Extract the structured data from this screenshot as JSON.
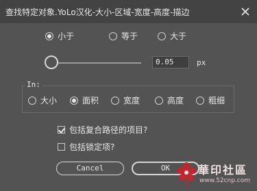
{
  "window": {
    "title": "查找特定对象.YoLo汉化-大小-区域-宽度-高度-描边"
  },
  "size_options": [
    {
      "label": "小于",
      "selected": true
    },
    {
      "label": "等于",
      "selected": false
    },
    {
      "label": "大于",
      "selected": false
    }
  ],
  "slider": {
    "value": "0.05",
    "unit": "px"
  },
  "in_group": {
    "label": "In:",
    "options": [
      {
        "label": "大小",
        "selected": false
      },
      {
        "label": "面积",
        "selected": true
      },
      {
        "label": "宽度",
        "selected": false
      },
      {
        "label": "高度",
        "selected": false
      },
      {
        "label": "粗细",
        "selected": false
      }
    ]
  },
  "checkboxes": {
    "compound_paths": {
      "label": "包括复合路径的项目?",
      "checked": true
    },
    "locked": {
      "label": "包括锁定项?",
      "checked": false
    }
  },
  "buttons": {
    "cancel": "Cancel",
    "ok": "OK"
  },
  "watermark": {
    "text": "華印社區",
    "url": "www.52cnp.com"
  },
  "colors": {
    "background": "#535353",
    "titlebar": "#434343",
    "text": "#e8e8e8",
    "watermark_red": "#c0262d"
  }
}
